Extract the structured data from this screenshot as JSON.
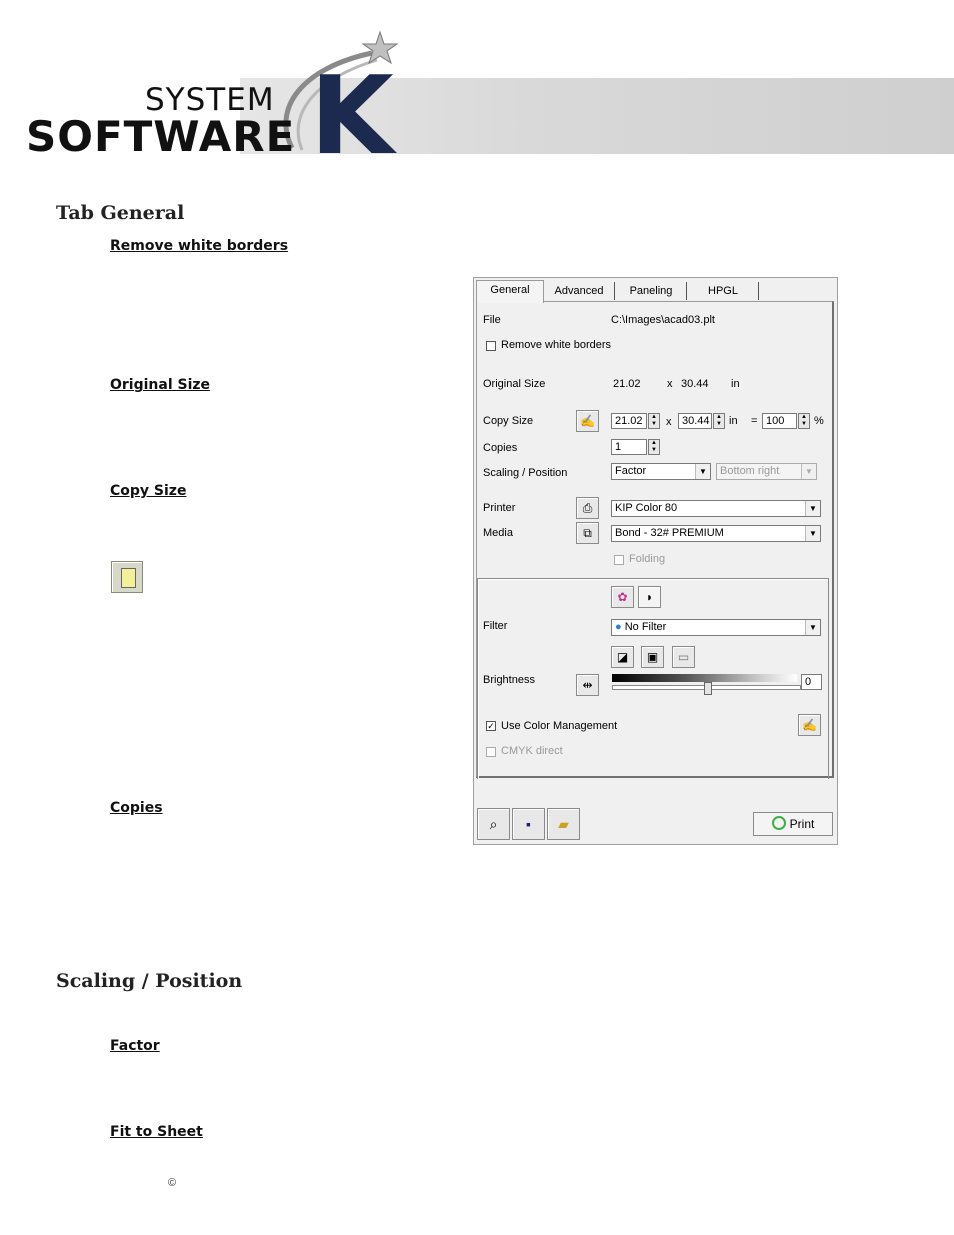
{
  "logo": {
    "line1": "SYSTEM",
    "line2": "SOFTWARE",
    "letter": "K"
  },
  "sections": {
    "tab_general": "Tab General",
    "remove_white_borders": "Remove white borders",
    "original_size": "Original Size",
    "copy_size": "Copy Size",
    "copies": "Copies",
    "scaling_position": "Scaling / Position",
    "factor": "Factor",
    "fit_to_sheet": "Fit to Sheet"
  },
  "copyright": "©",
  "dialog": {
    "tabs": [
      "General",
      "Advanced",
      "Paneling",
      "HPGL"
    ],
    "file_label": "File",
    "file_value": "C:\\Images\\acad03.plt",
    "remove_white_borders": "Remove white borders",
    "original_size_label": "Original Size",
    "original_w": "21.02",
    "original_x": "x",
    "original_h": "30.44",
    "original_unit": "in",
    "copy_size_label": "Copy Size",
    "copy_w": "21.02",
    "copy_x": "x",
    "copy_h": "30.44",
    "copy_unit": "in",
    "equals": "=",
    "percent_value": "100",
    "percent_sign": "%",
    "copies_label": "Copies",
    "copies_value": "1",
    "scaling_label": "Scaling / Position",
    "scaling_value": "Factor",
    "position_value": "Bottom right",
    "printer_label": "Printer",
    "printer_value": "KIP Color 80",
    "media_label": "Media",
    "media_value": "Bond - 32# PREMIUM",
    "folding_label": "Folding",
    "filter_label": "Filter",
    "filter_value": "No Filter",
    "brightness_label": "Brightness",
    "brightness_value": "0",
    "use_color_management": "Use Color Management",
    "cmyk_direct": "CMYK direct",
    "print_button": "Print"
  }
}
